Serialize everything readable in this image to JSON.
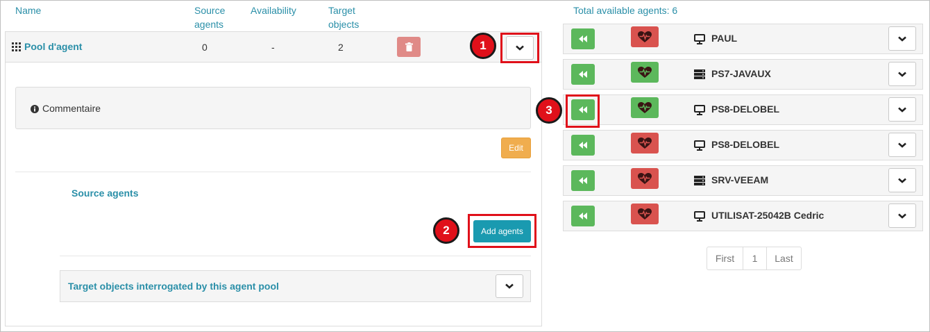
{
  "table_header": {
    "name": "Name",
    "source_agents": [
      "Source",
      "agents"
    ],
    "availability": "Availability",
    "target_objects": [
      "Target",
      "objects"
    ]
  },
  "pool": {
    "name": "Pool d'agent",
    "source_agents": "0",
    "availability": "-",
    "target_objects": "2",
    "comment_label": "Commentaire",
    "edit_label": "Edit",
    "source_agents_title": "Source agents",
    "add_agents_label": "Add agents",
    "target_section_title": "Target objects interrogated by this agent pool"
  },
  "callouts": [
    "1",
    "2",
    "3"
  ],
  "right_panel": {
    "total_label": "Total available agents: 6",
    "agents": [
      {
        "name": "PAUL",
        "type_icon": "monitor-icon",
        "health": "red",
        "health_icon": "heart-pulse-icon"
      },
      {
        "name": "PS7-JAVAUX",
        "type_icon": "server-icon",
        "health": "green",
        "health_icon": "heart-pulse-icon"
      },
      {
        "name": "PS8-DELOBEL",
        "type_icon": "monitor-icon",
        "health": "green",
        "health_icon": "heart-pulse-icon"
      },
      {
        "name": "PS8-DELOBEL",
        "type_icon": "monitor-icon",
        "health": "red",
        "health_icon": "heart-pulse-icon"
      },
      {
        "name": "SRV-VEEAM",
        "type_icon": "server-icon",
        "health": "red",
        "health_icon": "heart-pulse-icon"
      },
      {
        "name": "UTILISAT-25042B Cedric",
        "type_icon": "monitor-icon",
        "health": "red",
        "health_icon": "heart-pulse-icon"
      }
    ],
    "pagination": {
      "first": "First",
      "page": "1",
      "last": "Last"
    }
  },
  "colors": {
    "accent": "#2a8fa8",
    "danger": "#d9534f",
    "success": "#5cb85c",
    "warning": "#f0ad4e",
    "primary": "#1a9ab0",
    "highlight": "#e0101a"
  }
}
